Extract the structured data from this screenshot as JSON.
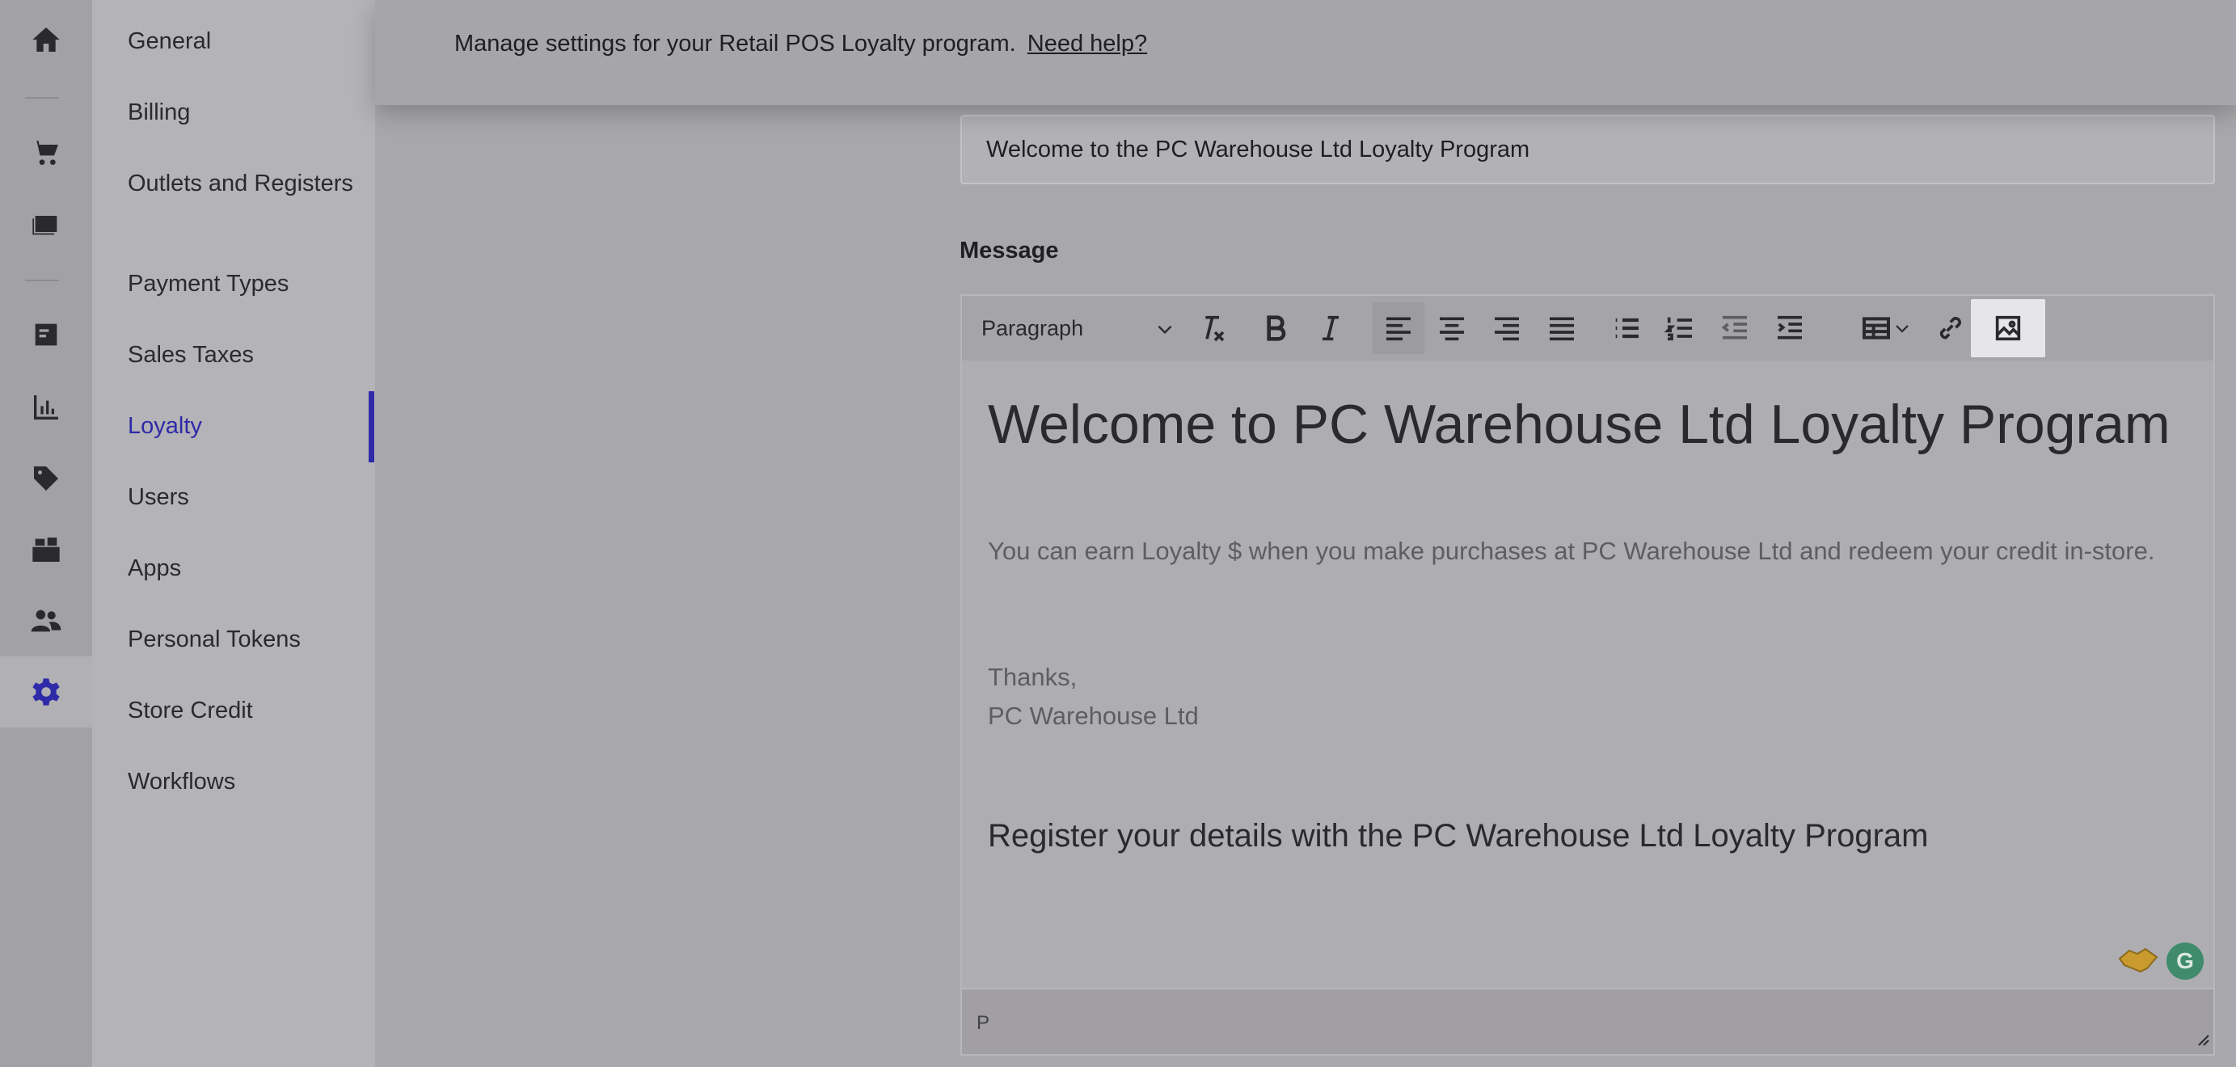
{
  "rail": {
    "icons": [
      "home-icon",
      "cart-icon",
      "sales-ledger-icon",
      "register-icon",
      "reports-chart-icon",
      "tag-icon",
      "inventory-boxes-icon",
      "customers-icon",
      "settings-gear-icon"
    ]
  },
  "nav": {
    "items": [
      {
        "label": "General"
      },
      {
        "label": "Billing"
      },
      {
        "label": "Outlets and Registers"
      },
      {
        "label": "Payment Types"
      },
      {
        "label": "Sales Taxes"
      },
      {
        "label": "Loyalty"
      },
      {
        "label": "Users"
      },
      {
        "label": "Apps"
      },
      {
        "label": "Personal Tokens"
      },
      {
        "label": "Store Credit"
      },
      {
        "label": "Workflows"
      }
    ],
    "active": "Loyalty"
  },
  "header": {
    "text": "Manage settings for your Retail POS Loyalty program.",
    "help_link": "Need help?"
  },
  "form": {
    "subject_value": "Welcome to the PC Warehouse Ltd Loyalty Program",
    "message_label": "Message"
  },
  "editor": {
    "block_format": "Paragraph",
    "toolbar_icons": [
      "clear-formatting-icon",
      "bold-icon",
      "italic-icon",
      "align-left-icon",
      "align-center-icon",
      "align-right-icon",
      "justify-icon",
      "bullet-list-icon",
      "numbered-list-icon",
      "outdent-icon",
      "indent-icon",
      "table-icon",
      "link-icon",
      "image-icon"
    ],
    "content": {
      "heading": "Welcome to PC Warehouse Ltd Loyalty Program",
      "paragraph": "You can earn Loyalty $ when you make purchases at PC Warehouse Ltd and redeem your credit in-store.",
      "thanks": "Thanks,",
      "signature": "PC Warehouse Ltd",
      "subheading": "Register your details with the PC Warehouse Ltd Loyalty Program"
    },
    "status_path": "P",
    "grammarly_letter": "G"
  },
  "colors": {
    "accent": "#2f2aa8",
    "grammarly": "#3f8b6b"
  }
}
